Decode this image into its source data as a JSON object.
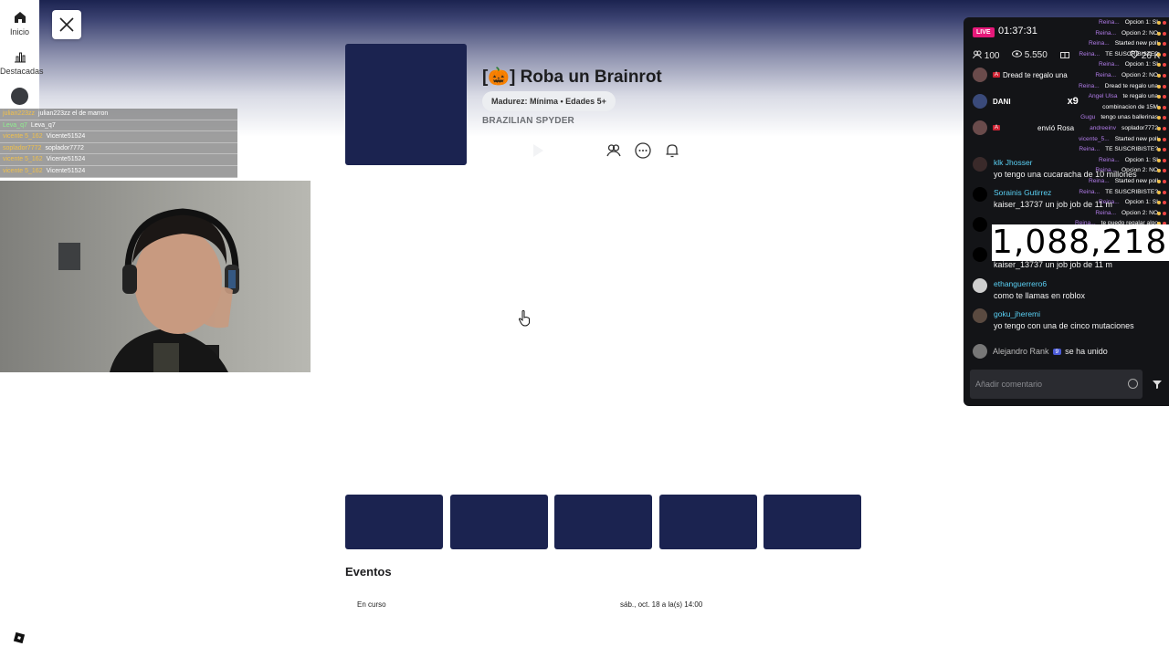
{
  "nav": {
    "home_label": "Inicio",
    "featured_label": "Destacadas"
  },
  "mini_chat": {
    "rows": [
      {
        "user": "julian223zz",
        "text": "julian223zz el de marron"
      },
      {
        "user": "Leva_q7",
        "text": "Leva_q7"
      },
      {
        "user": "vicente 5_162",
        "text": "Vicente51524"
      },
      {
        "user": "soplador7772",
        "text": "soplador7772"
      },
      {
        "user": "vicente 5_162",
        "text": "Vicente51524"
      },
      {
        "user": "vicente 5_162",
        "text": "Vicente51524"
      }
    ]
  },
  "game": {
    "title": "[🎃] Roba un Brainrot",
    "maturity": "Madurez: Mínima • Edades 5+",
    "creator": "BRAZILIAN SPYDER"
  },
  "events": {
    "title": "Eventos",
    "status": "En curso",
    "date": "sáb., oct. 18 a la(s) 14:00"
  },
  "stream_chat": {
    "live": "LIVE",
    "timer": "01:37:31",
    "followers": "100",
    "viewers": "5.550",
    "likes": "26 K",
    "overlay_rows": [
      {
        "text": "Opcion 1: SI",
        "tag": "Reina..."
      },
      {
        "text": "Opcion 2: NO",
        "tag": "Reina..."
      },
      {
        "text": "Started new poll",
        "tag": "Reina..."
      },
      {
        "text": "TE SUSCRIBISTE?",
        "tag": "Reina..."
      },
      {
        "text": "Opcion 1: SI",
        "tag": "Reina..."
      },
      {
        "text": "Opcion 2: NO",
        "tag": "Reina..."
      },
      {
        "text": "Dread te regalo una",
        "tag": "Reina..."
      },
      {
        "text": "te regalo una",
        "tag": "Angel Ulsa"
      },
      {
        "text": "combinacion de 15M",
        "tag": ""
      },
      {
        "text": "tengo unas ballerinas",
        "tag": "Gugu"
      },
      {
        "text": "soplador7772",
        "tag": "andreeinv"
      },
      {
        "text": "Started new poll",
        "tag": "vicente_5..."
      },
      {
        "text": "TE SUSCRIBISTE?",
        "tag": "Reina..."
      },
      {
        "text": "Opcion 1: SI",
        "tag": "Reina..."
      },
      {
        "text": "Opcion 2: NO",
        "tag": "Reina..."
      },
      {
        "text": "Started new poll",
        "tag": "Reina..."
      },
      {
        "text": "TE SUSCRIBISTE?",
        "tag": "Reina..."
      },
      {
        "text": "Opcion 1: SI",
        "tag": "Reina..."
      },
      {
        "text": "Opcion 2: NO",
        "tag": "Reina..."
      },
      {
        "text": "te puedo regalar algo",
        "tag": "Reina..."
      }
    ],
    "gift_1": "Dread te regalo una",
    "gift_2_user": "DANI",
    "gift_2_count": "x9",
    "gift_3": "envió Rosa",
    "messages": [
      {
        "user": "klk Jhosser",
        "text": "yo tengo una cucaracha de 10 millones"
      },
      {
        "user": "Sorainis Gutirrez",
        "text": "kaiser_13737 un job job de 11 m"
      },
      {
        "user": "",
        "text": ""
      },
      {
        "user": "",
        "text": "kaiser_13737 un job job de 11 m"
      },
      {
        "user": "ethanguerrero6",
        "text": "como te llamas en roblox"
      },
      {
        "user": "goku_jheremi",
        "text": "yo tengo con una de cinco mutaciones"
      }
    ],
    "big_number": "1,088,218",
    "join_user": "Alejandro Rank",
    "join_level": "9",
    "join_text": "se ha unido",
    "comment_placeholder": "Añadir comentario"
  }
}
